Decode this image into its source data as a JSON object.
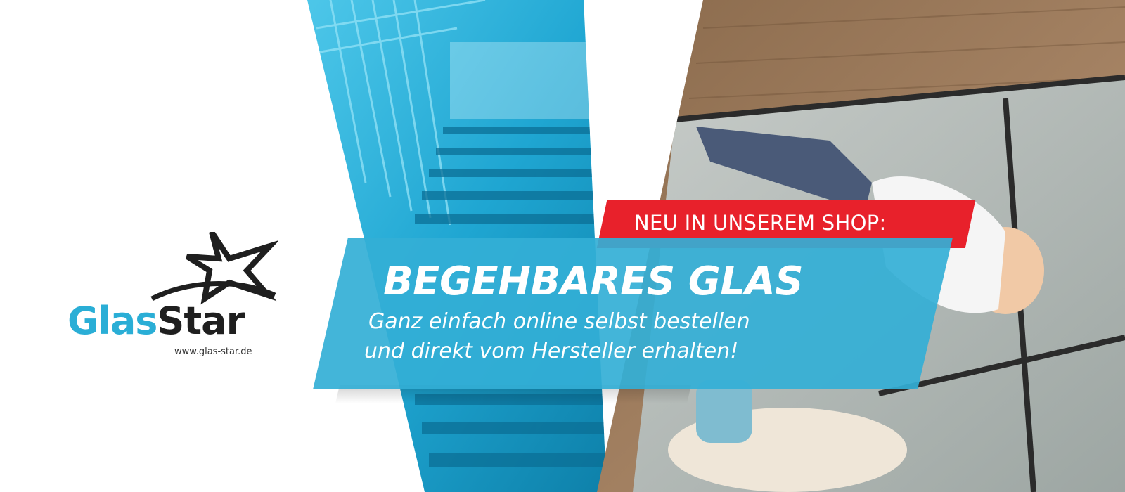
{
  "banner": {
    "eyebrow": "NEU IN UNSEREM SHOP:",
    "headline": "BEGEHBARES GLAS",
    "subline_1": "Ganz einfach online selbst bestellen",
    "subline_2": "und direkt vom Hersteller erhalten!"
  },
  "logo": {
    "name_part_1": "Glas",
    "name_part_2": "Star",
    "url": "www.glas-star.de"
  },
  "colors": {
    "brand_blue": "#2aaed6",
    "accent_red": "#e8212b",
    "dark": "#1f1f1f"
  }
}
